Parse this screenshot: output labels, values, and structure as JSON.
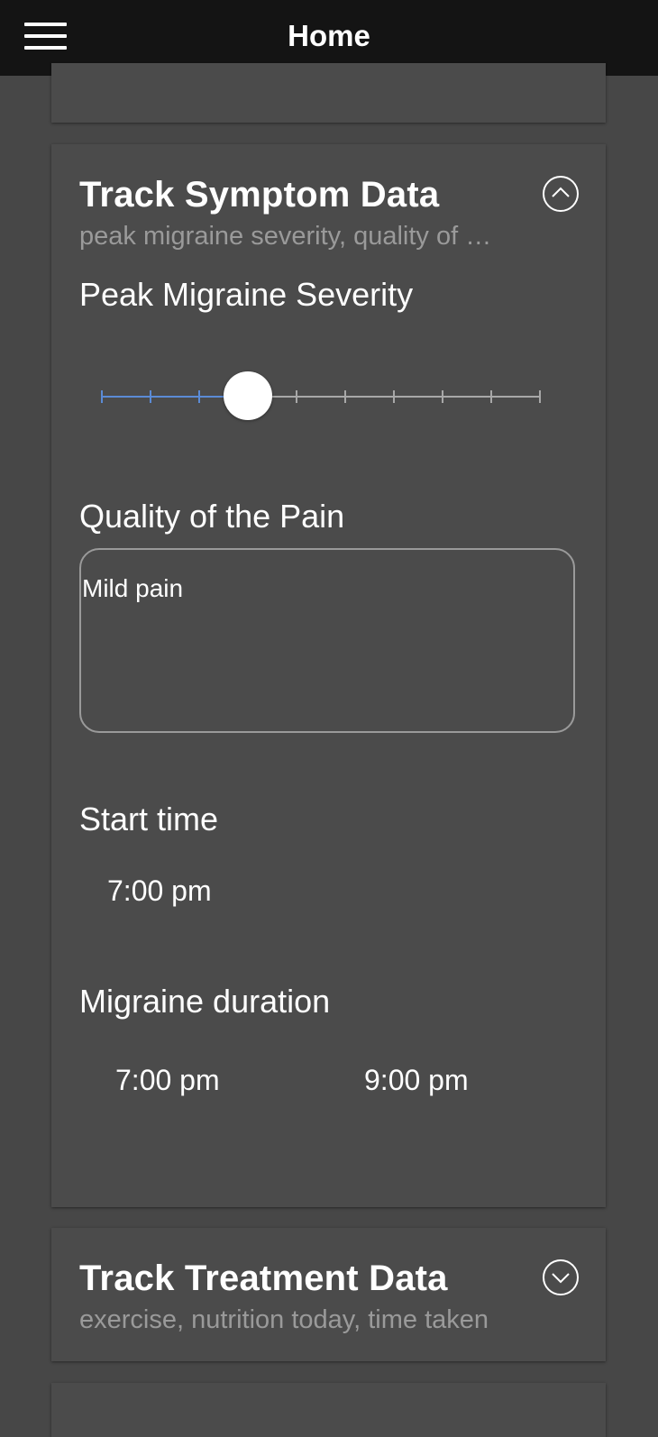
{
  "header": {
    "title": "Home"
  },
  "symptom_card": {
    "title": "Track Symptom Data",
    "subtitle": "peak migraine severity, quality of the pain, start time, migraine duration",
    "severity": {
      "label": "Peak Migraine Severity",
      "value_fraction": 0.333,
      "tick_count": 10
    },
    "pain_quality": {
      "label": "Quality of the Pain",
      "value": "Mild pain"
    },
    "start_time": {
      "label": "Start time",
      "value": "7:00 pm"
    },
    "duration": {
      "label": "Migraine duration",
      "from": "7:00 pm",
      "to": "9:00 pm"
    }
  },
  "treatment_card": {
    "title": "Track Treatment Data",
    "subtitle": "exercise, nutrition today, time taken"
  },
  "colors": {
    "background": "#474747",
    "card": "#4b4b4b",
    "header": "#141414",
    "slider_active": "#5b8bd6",
    "slider_inactive": "#a8a8a8",
    "subtitle": "#9a9a9a"
  }
}
